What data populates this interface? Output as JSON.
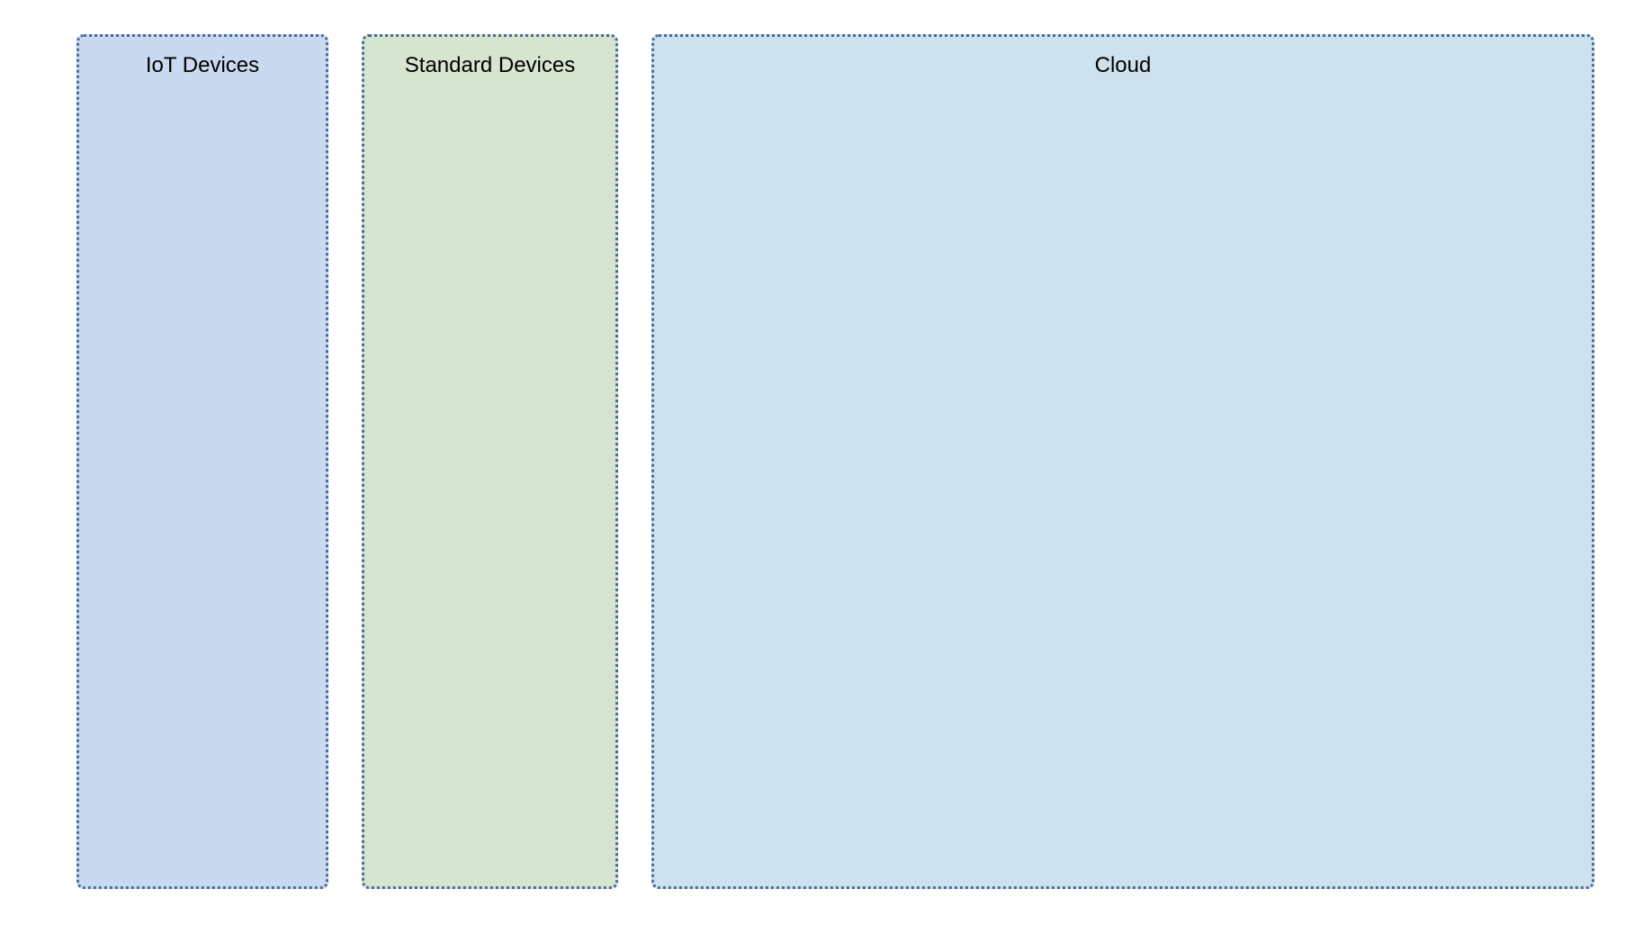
{
  "panels": {
    "iot": {
      "title": "IoT Devices"
    },
    "standard": {
      "title": "Standard Devices"
    },
    "cloud": {
      "title": "Cloud"
    }
  }
}
